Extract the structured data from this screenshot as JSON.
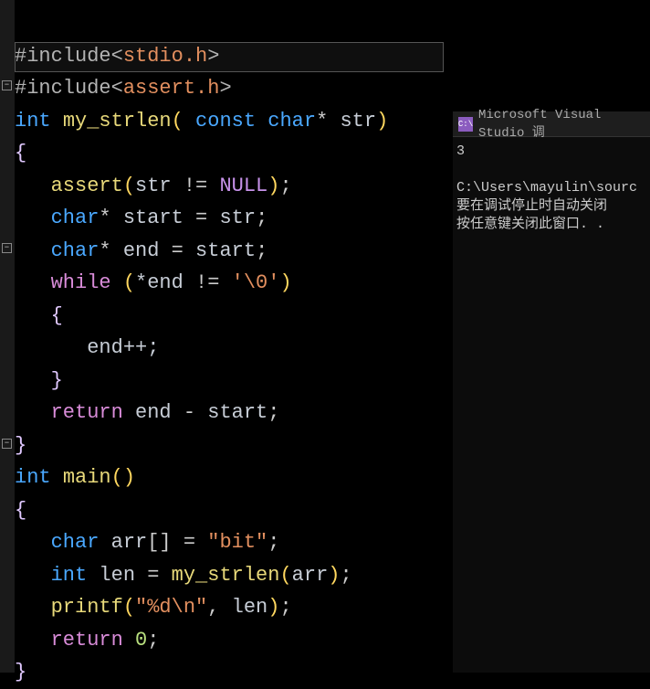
{
  "code": {
    "include1_pre": "#include",
    "include1_hdr": "stdio.h",
    "include2_pre": "#include",
    "include2_hdr": "assert.h",
    "fn1_ret": "int",
    "fn1_name": "my_strlen",
    "fn1_const": "const",
    "fn1_ptype": "char",
    "fn1_pname": "str",
    "assert_call": "assert",
    "assert_arg": "str",
    "assert_op": "!=",
    "assert_null": "NULL",
    "decl1_type": "char",
    "decl1_name": "start",
    "decl1_val": "str",
    "decl2_type": "char",
    "decl2_name": "end",
    "decl2_val": "start",
    "while_kw": "while",
    "while_deref": "*end",
    "while_op": "!=",
    "while_lit": "'\\0'",
    "inc_stmt": "end++;",
    "ret_kw": "return",
    "ret_a": "end",
    "ret_op": "-",
    "ret_b": "start",
    "fn2_ret": "int",
    "fn2_name": "main",
    "arr_type": "char",
    "arr_name": "arr",
    "arr_lit": "\"bit\"",
    "len_type": "int",
    "len_name": "len",
    "len_call": "my_strlen",
    "len_arg": "arr",
    "printf_name": "printf",
    "printf_fmt": "\"%d\\n\"",
    "printf_arg": "len",
    "ret0_kw": "return",
    "ret0_val": "0"
  },
  "console": {
    "title_logo": "C:\\",
    "title_text": "Microsoft Visual Studio 调",
    "output": "3",
    "line1": "C:\\Users\\mayulin\\sourc",
    "line2": "要在调试停止时自动关闭",
    "line3": "按任意键关闭此窗口. ."
  }
}
